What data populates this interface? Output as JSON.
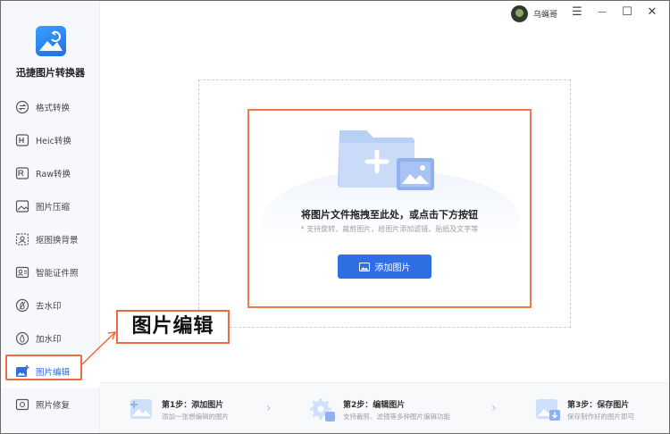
{
  "app": {
    "name": "迅捷图片转换器"
  },
  "user": {
    "name": "乌蝇哥"
  },
  "window_controls": {
    "menu": "☰",
    "minimize": "—",
    "maximize": "☐",
    "close": "✕"
  },
  "sidebar": {
    "items": [
      {
        "label": "格式转换",
        "icon": "format-convert-icon"
      },
      {
        "label": "Heic转换",
        "icon": "heic-icon"
      },
      {
        "label": "Raw转换",
        "icon": "raw-icon"
      },
      {
        "label": "图片压缩",
        "icon": "compress-icon"
      },
      {
        "label": "抠图换背景",
        "icon": "cutout-icon"
      },
      {
        "label": "智能证件照",
        "icon": "id-photo-icon"
      },
      {
        "label": "去水印",
        "icon": "remove-watermark-icon"
      },
      {
        "label": "加水印",
        "icon": "add-watermark-icon"
      },
      {
        "label": "图片编辑",
        "icon": "image-edit-icon",
        "active": true
      },
      {
        "label": "照片修复",
        "icon": "photo-repair-icon"
      }
    ]
  },
  "dropzone": {
    "title": "将图片文件拖拽至此处，或点击下方按钮",
    "hint": "* 支持旋转、裁剪图片，给图片添加滤镜、贴纸及文字等",
    "button_label": "添加图片"
  },
  "callout": {
    "text": "图片编辑"
  },
  "steps": [
    {
      "title": "第1步：添加图片",
      "desc": "添加一张想编辑的图片"
    },
    {
      "title": "第2步：编辑图片",
      "desc": "支持裁剪、滤镜等多种图片编辑功能"
    },
    {
      "title": "第3步：保存图片",
      "desc": "保存制作好的图片即可"
    }
  ],
  "colors": {
    "accent": "#2f6fe4",
    "highlight": "#ee6b3f"
  }
}
